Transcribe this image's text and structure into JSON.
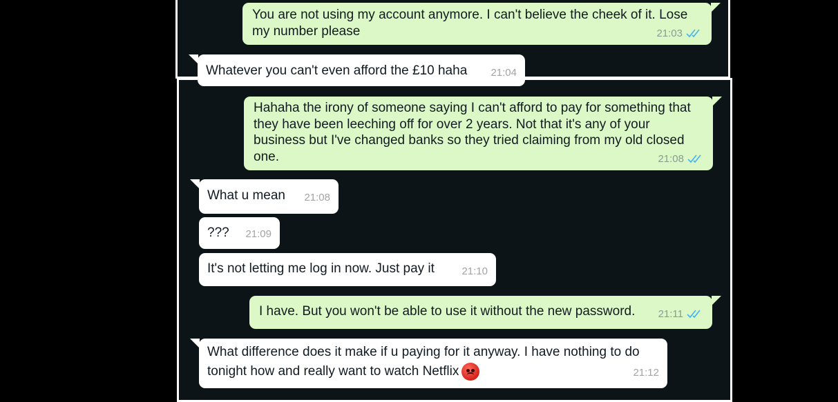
{
  "messages": [
    {
      "direction": "out",
      "text": "You are not using my account anymore. I can't believe the cheek of it. Lose my number please",
      "time": "21:03",
      "read": true
    },
    {
      "direction": "in",
      "text": "Whatever you can't even afford the £10 haha",
      "time": "21:04"
    },
    {
      "direction": "out",
      "text": "Hahaha the irony of someone saying I can't afford to pay for something that they have been leeching off for over 2 years. Not that it's any of your business but I've changed banks so they tried claiming from my old closed one.",
      "time": "21:08",
      "read": true
    },
    {
      "direction": "in",
      "text": "What u mean",
      "time": "21:08"
    },
    {
      "direction": "in",
      "text": "???",
      "time": "21:09"
    },
    {
      "direction": "in",
      "text": "It's not letting me log in now. Just pay it",
      "time": "21:10"
    },
    {
      "direction": "out",
      "text": "I have. But you won't be able to use it without the new password.",
      "time": "21:11",
      "read": true
    },
    {
      "direction": "in",
      "text": "What difference does it make if u paying for it anyway. I have nothing to do tonight how and really want to watch Netflix",
      "time": "21:12",
      "emoji": "angry-face"
    }
  ],
  "colors": {
    "outgoing_bubble": "#dcf8c6",
    "incoming_bubble": "#ffffff",
    "chat_background": "#0d1418",
    "read_ticks": "#4fb6ec"
  }
}
